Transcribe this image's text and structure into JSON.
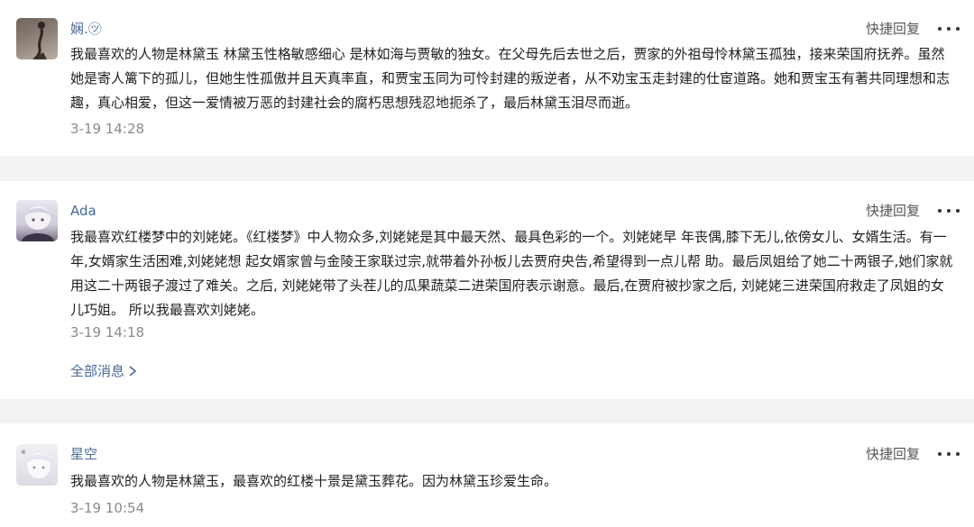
{
  "comments": [
    {
      "user": "娴.㋡",
      "quick_reply": "快捷回复",
      "more_icon": "more-horizontal-icon",
      "text": "我最喜欢的人物是林黛玉 林黛玉性格敏感细心 是林如海与贾敏的独女。在父母先后去世之后，贾家的外祖母怜林黛玉孤独，接来荣国府抚养。虽然她是寄人篱下的孤儿，但她生性孤傲并且天真率直，和贾宝玉同为可怜封建的叛逆者，从不劝宝玉走封建的仕宦道路。她和贾宝玉有著共同理想和志趣，真心相爱，但这一爱情被万恶的封建社会的腐朽思想残忍地扼杀了，最后林黛玉泪尽而逝。",
      "time": "3-19 14:28"
    },
    {
      "user": "Ada",
      "quick_reply": "快捷回复",
      "more_icon": "more-horizontal-icon",
      "text": "我最喜欢红楼梦中的刘姥姥。《红楼梦》中人物众多,刘姥姥是其中最天然、最具色彩的一个。刘姥姥早 年丧偶,膝下无儿,依傍女儿、女婿生活。有一年,女婿家生活困难,刘姥姥想 起女婿家曾与金陵王家联过宗,就带着外孙板儿去贾府央告,希望得到一点儿帮 助。最后凤姐给了她二十两银子,她们家就用这二十两银子渡过了难关。之后, 刘姥姥带了头茬儿的瓜果蔬菜二进荣国府表示谢意。最后,在贾府被抄家之后, 刘姥姥三进荣国府救走了凤姐的女儿巧姐。 所以我最喜欢刘姥姥。",
      "time": "3-19 14:18",
      "all_messages": "全部消息"
    },
    {
      "user": "星空",
      "quick_reply": "快捷回复",
      "more_icon": "more-horizontal-icon",
      "text": "我最喜欢的人物是林黛玉，最喜欢的红楼十景是黛玉葬花。因为林黛玉珍爱生命。",
      "time": "3-19 10:54"
    }
  ],
  "colors": {
    "page_bg": "#f2f3f5",
    "card_bg": "#ffffff",
    "name": "#4a6a96",
    "time": "#8a8a8a",
    "link": "#4a6a96"
  }
}
